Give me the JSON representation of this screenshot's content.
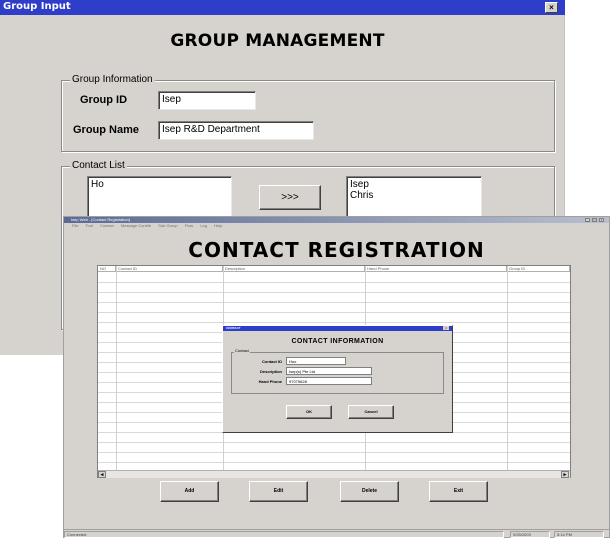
{
  "group_input": {
    "title": "Group Input",
    "close_glyph": "×",
    "heading": "GROUP MANAGEMENT",
    "group_info": {
      "legend": "Group Information",
      "group_id_label": "Group ID",
      "group_id_value": "Isep",
      "group_name_label": "Group Name",
      "group_name_value": "Isep R&D Department"
    },
    "contact_list": {
      "legend": "Contact List",
      "available": [
        "Ho"
      ],
      "transfer_label": ">>>",
      "selected": [
        "Isep",
        "Chris"
      ]
    }
  },
  "contact_registration": {
    "title": "Isep Web - [Contact Registration]",
    "menu": [
      "File",
      "Tool",
      "Contact",
      "Message Contrib",
      "Sub Group",
      "Flow",
      "Log",
      "Help"
    ],
    "window_controls": [
      "_",
      "□",
      "×"
    ],
    "heading": "CONTACT   REGISTRATION",
    "grid": {
      "columns": [
        "NO",
        "Contact ID",
        "Description",
        "Hand Phone",
        "Group ID"
      ]
    },
    "scroll_left": "◄",
    "scroll_right": "►",
    "buttons": {
      "add": "Add",
      "edit": "Edit",
      "delete": "Delete",
      "exit": "Exit"
    },
    "status": {
      "left": "Connected",
      "date": "9/25/2003",
      "time": "5:14 PM"
    }
  },
  "contact_dialog": {
    "title": "CONTACT",
    "close_glyph": "×",
    "heading": "CONTACT INFORMATION",
    "legend": "Contact",
    "contact_id_label": "Contact ID",
    "contact_id_value": "Hoo",
    "description_label": "Description",
    "description_value": "Isep(s) Pte Ltd",
    "hand_phone_label": "Hand Phone",
    "hand_phone_value": "97075628",
    "ok_label": "OK",
    "cancel_label": "Cancel"
  },
  "colors": {
    "titlebar_active": "#2e3ec8",
    "window_face": "#d6d3ce"
  }
}
